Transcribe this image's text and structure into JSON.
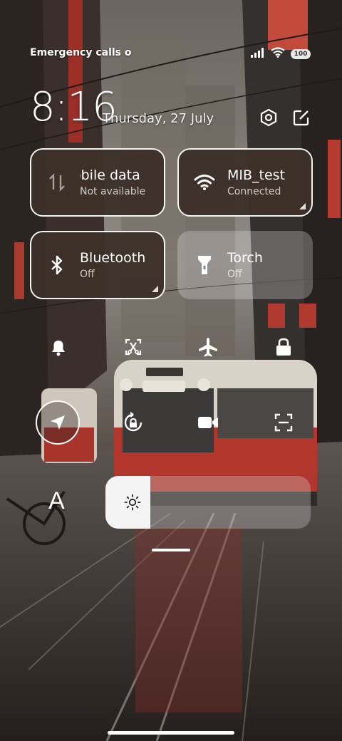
{
  "status_bar": {
    "carrier_text": "Emergency calls o",
    "battery_level": "100",
    "icons": [
      "signal-icon",
      "wifi-icon",
      "battery-icon"
    ]
  },
  "header": {
    "time": "8:16",
    "date": "Thursday, 27 July",
    "icons": [
      "settings-icon",
      "edit-icon"
    ]
  },
  "tiles": {
    "mobile_data": {
      "title": "obile data",
      "subtitle": "Not available",
      "active": true
    },
    "wifi": {
      "title": "MIB_test",
      "subtitle": "Connected",
      "active": true
    },
    "bluetooth": {
      "title": "Bluetooth",
      "subtitle": "Off",
      "active": true
    },
    "torch": {
      "title": "Torch",
      "subtitle": "Off",
      "active": false
    }
  },
  "toggles": {
    "row1": [
      "bell-icon",
      "screenshot-icon",
      "airplane-icon",
      "lock-icon"
    ],
    "row2": [
      "location-icon",
      "rotation-lock-icon",
      "video-record-icon",
      "scan-icon"
    ]
  },
  "brightness": {
    "level": 0.22,
    "label": "A"
  },
  "colors": {
    "tile_dark": "#3c302a",
    "tile_border": "#f2f2f2",
    "accent": "#ffffff"
  }
}
